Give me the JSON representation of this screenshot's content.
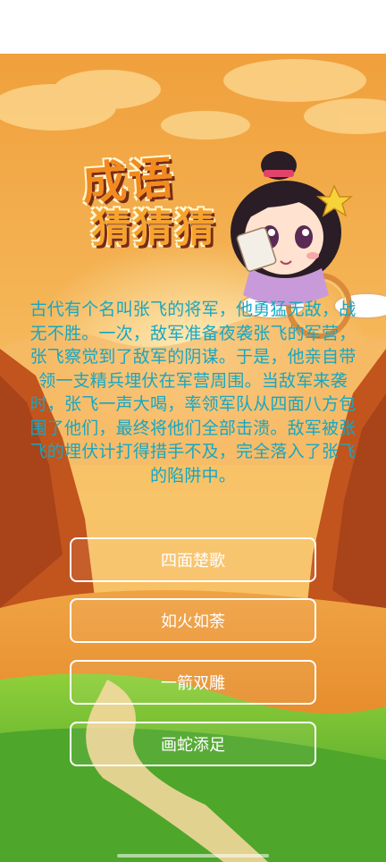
{
  "logo": {
    "line1": "成语",
    "line2": "猜猜猜",
    "icon": "cartoon-girl-mascot"
  },
  "question": {
    "story": "古代有个名叫张飞的将军，他勇猛无敌，战无不胜。一次，敌军准备夜袭张飞的军营，张飞察觉到了敌军的阴谋。于是，他亲自带领一支精兵埋伏在军营周围。当敌军来袭时，张飞一声大喝，率领军队从四面八方包围了他们，最终将他们全部击溃。敌军被张飞的埋伏计打得措手不及，完全落入了张飞的陷阱中。"
  },
  "options": [
    {
      "label": "四面楚歌"
    },
    {
      "label": "如火如荼"
    },
    {
      "label": "一箭双雕"
    },
    {
      "label": "画蛇添足"
    }
  ],
  "colors": {
    "story_text": "#17a7c3",
    "sky_top": "#f3a640",
    "sky_bottom": "#f8c26a",
    "grass": "#5fb32e",
    "button_border": "#ffffff"
  }
}
